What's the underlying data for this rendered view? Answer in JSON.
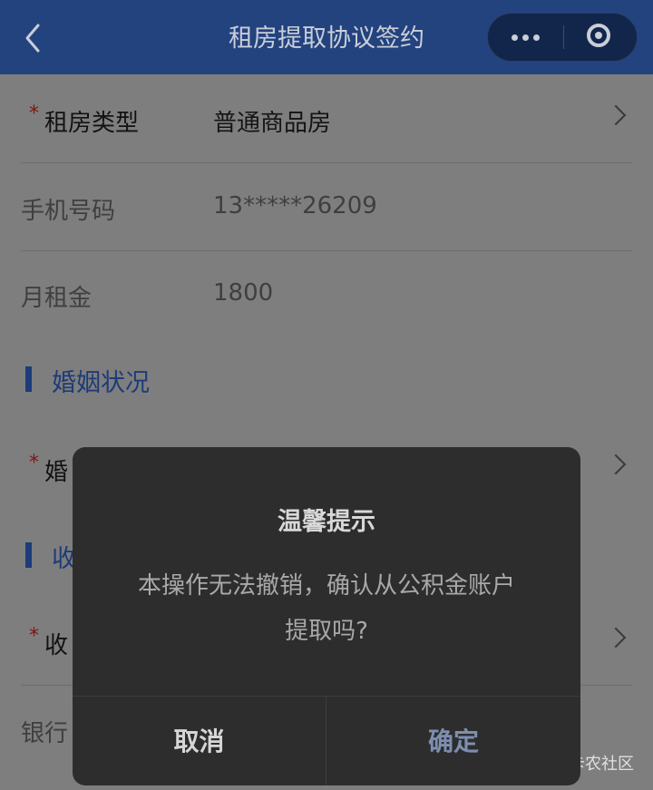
{
  "header": {
    "title": "租房提取协议签约",
    "back_icon": "chevron-left-icon",
    "more_icon": "more-dots-icon",
    "close_icon": "target-circle-icon"
  },
  "form": {
    "rent_type": {
      "label": "租房类型",
      "value": "普通商品房",
      "required_mark": "*"
    },
    "phone": {
      "label": "手机号码",
      "value": "13*****26209"
    },
    "monthly_rent": {
      "label": "月租金",
      "value": "1800"
    },
    "marriage_section": {
      "title": "婚姻状况"
    },
    "marriage_row": {
      "label": "婚",
      "required_mark": "*"
    },
    "receive_section": {
      "title": "收"
    },
    "receive_row": {
      "label": "收",
      "required_mark": "*"
    },
    "bank_row": {
      "label": "银行"
    }
  },
  "dialog": {
    "title": "温馨提示",
    "message_line1": "本操作无法撤销，确认从公积金账户",
    "message_line2": "提取吗?",
    "cancel_label": "取消",
    "confirm_label": "确定"
  },
  "watermark": "卡农社区",
  "colors": {
    "header_bg": "#23437f",
    "accent": "#1d3b78",
    "required": "#7d1614",
    "dialog_bg": "#2d2d2d",
    "confirm_text": "#7d8fb0"
  }
}
